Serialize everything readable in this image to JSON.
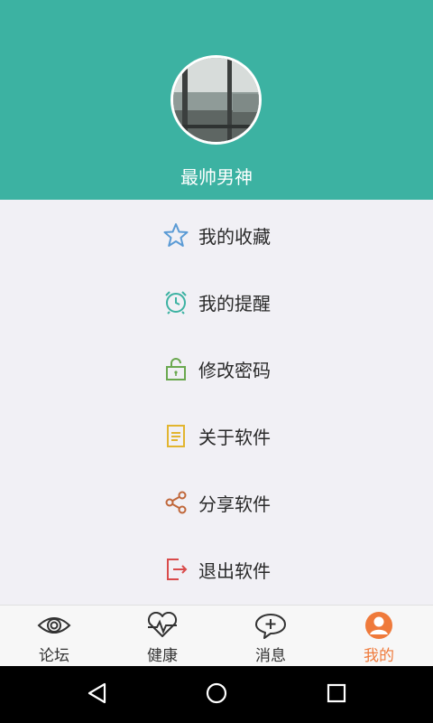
{
  "profile": {
    "username": "最帅男神",
    "avatar": "avatar-photo"
  },
  "menu": [
    {
      "label": "我的收藏",
      "icon": "star-icon",
      "color": "#5b9bd5"
    },
    {
      "label": "我的提醒",
      "icon": "alarm-clock-icon",
      "color": "#3cb2a2"
    },
    {
      "label": "修改密码",
      "icon": "unlock-icon",
      "color": "#6aa84f"
    },
    {
      "label": "关于软件",
      "icon": "document-icon",
      "color": "#e2b52f"
    },
    {
      "label": "分享软件",
      "icon": "share-icon",
      "color": "#c0673a"
    },
    {
      "label": "退出软件",
      "icon": "exit-icon",
      "color": "#d94b4b"
    }
  ],
  "tabs": [
    {
      "label": "论坛",
      "icon": "eye-icon",
      "active": false
    },
    {
      "label": "健康",
      "icon": "heart-pulse-icon",
      "active": false
    },
    {
      "label": "消息",
      "icon": "chat-bubble-icon",
      "active": false
    },
    {
      "label": "我的",
      "icon": "person-icon",
      "active": true
    }
  ],
  "colors": {
    "header": "#3cb2a2",
    "active_tab": "#ef7a3b",
    "background": "#f1f0f5"
  },
  "system_nav": [
    "back-icon",
    "home-icon",
    "recents-icon"
  ]
}
